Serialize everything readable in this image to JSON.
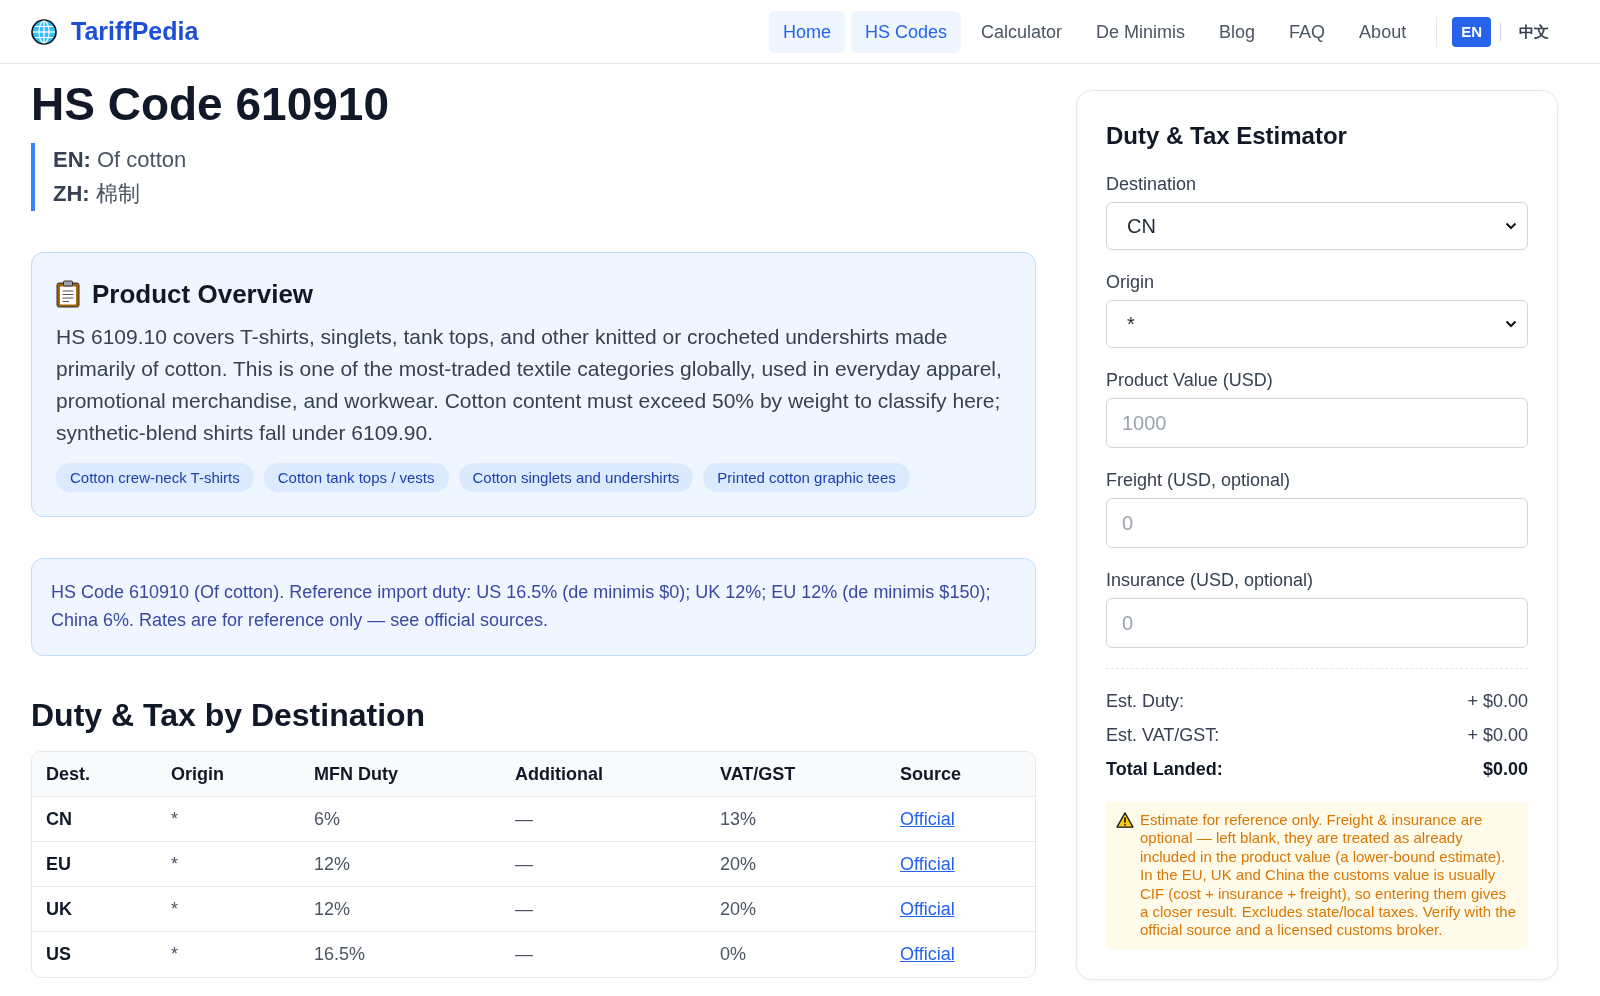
{
  "header": {
    "logo": "TariffPedia",
    "nav": [
      {
        "label": "Home",
        "selected": true
      },
      {
        "label": "HS Codes",
        "selected": true
      },
      {
        "label": "Calculator",
        "selected": false
      },
      {
        "label": "De Minimis",
        "selected": false
      },
      {
        "label": "Blog",
        "selected": false
      },
      {
        "label": "FAQ",
        "selected": false
      },
      {
        "label": "About",
        "selected": false
      }
    ],
    "languages": [
      {
        "label": "EN",
        "selected": true
      },
      {
        "label": "中文",
        "selected": false
      }
    ]
  },
  "page": {
    "title": "HS Code 610910",
    "descriptions": [
      "**EN:** Of cotton",
      "**ZH:** 棉制"
    ]
  },
  "overview": {
    "title": "Product Overview",
    "text": "HS 6109.10 covers T-shirts, singlets, tank tops, and other knitted or crocheted undershirts made primarily of cotton. This is one of the most-traded textile categories globally, used in everyday apparel, promotional merchandise, and workwear. Cotton content must exceed 50% by weight to classify here; synthetic-blend shirts fall under 6109.90.",
    "tags": [
      "Cotton crew-neck T-shirts",
      "Cotton tank tops / vests",
      "Cotton singlets and undershirts",
      "Printed cotton graphic tees"
    ]
  },
  "note": "HS Code 610910 (Of cotton). Reference import duty: US 16.5% (de minimis $0); UK 12%; EU 12% (de minimis $150); China 6%. Rates are for reference only — see official sources.",
  "duty_table": {
    "title": "Duty & Tax by Destination",
    "columns": [
      {
        "label": "Dest.",
        "kind": "key"
      },
      {
        "label": "Origin",
        "kind": "text"
      },
      {
        "label": "MFN Duty",
        "kind": "text"
      },
      {
        "label": "Additional",
        "kind": "text"
      },
      {
        "label": "VAT/GST",
        "kind": "text"
      },
      {
        "label": "Source",
        "kind": "link"
      }
    ],
    "rows": [
      {
        "cells": [
          "CN",
          "*",
          "6%",
          "—",
          "13%",
          "Official"
        ]
      },
      {
        "cells": [
          "EU",
          "*",
          "12%",
          "—",
          "20%",
          "Official"
        ]
      },
      {
        "cells": [
          "UK",
          "*",
          "12%",
          "—",
          "20%",
          "Official"
        ]
      },
      {
        "cells": [
          "US",
          "*",
          "16.5%",
          "—",
          "0%",
          "Official"
        ]
      }
    ]
  },
  "estimator": {
    "title": "Duty & Tax Estimator",
    "fields": [
      {
        "kind": "select",
        "label": "Destination",
        "value": "CN"
      },
      {
        "kind": "select",
        "label": "Origin",
        "value": "*"
      },
      {
        "kind": "input",
        "label": "Product Value (USD)",
        "placeholder": "1000"
      },
      {
        "kind": "input",
        "label": "Freight (USD, optional)",
        "placeholder": "0"
      },
      {
        "kind": "input",
        "label": "Insurance (USD, optional)",
        "placeholder": "0"
      }
    ],
    "results": [
      {
        "kind": "line",
        "label": "Est. Duty:",
        "value": "+ $0.00"
      },
      {
        "kind": "line",
        "label": "Est. VAT/GST:",
        "value": "+ $0.00"
      },
      {
        "kind": "total",
        "label": "Total Landed:",
        "value": "$0.00"
      }
    ],
    "warning": "Estimate for reference only. Freight & insurance are optional — left blank, they are treated as already included in the product value (a lower-bound estimate). In the EU, UK and China the customs value is usually CIF (cost + insurance + freight), so entering them gives a closer result. Excludes state/local taxes. Verify with the official source and a licensed customs broker."
  }
}
